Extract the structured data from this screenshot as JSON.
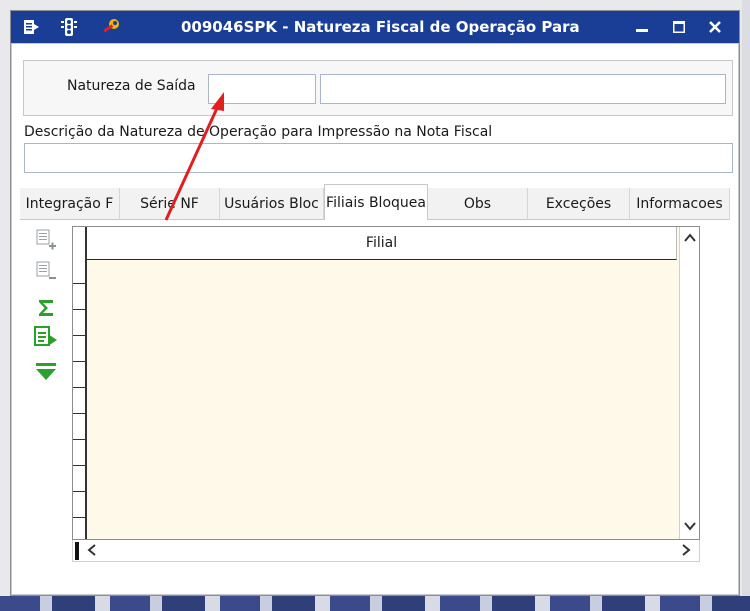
{
  "window": {
    "title": "009046SPK - Natureza Fiscal de Operação Para",
    "controls": {
      "minimize": "▬",
      "maximize": "☐",
      "close": "X"
    }
  },
  "form": {
    "natureza_label": "Natureza de Saída",
    "natureza_code_value": "",
    "natureza_desc_value": "",
    "descricao_label": "Descrição da Natureza de Operação para Impressão na Nota Fiscal",
    "descricao_value": ""
  },
  "tabs": [
    {
      "label": "Integração F"
    },
    {
      "label": "Série NF"
    },
    {
      "label": "Usuários Bloc"
    },
    {
      "label": "Filiais Bloquea"
    },
    {
      "label": "Obs"
    },
    {
      "label": "Exceções"
    },
    {
      "label": "Informacoes"
    }
  ],
  "active_tab": "Filiais Bloquea",
  "grid": {
    "columns": [
      "Filial"
    ],
    "rows": []
  },
  "side_tools": [
    "add-row-icon",
    "remove-row-icon",
    "sum-icon",
    "export-icon",
    "move-last-icon"
  ],
  "colors": {
    "titlebar": "#1a3e96",
    "grid_bg": "#fff9ea",
    "annotation_arrow": "#e02020"
  }
}
